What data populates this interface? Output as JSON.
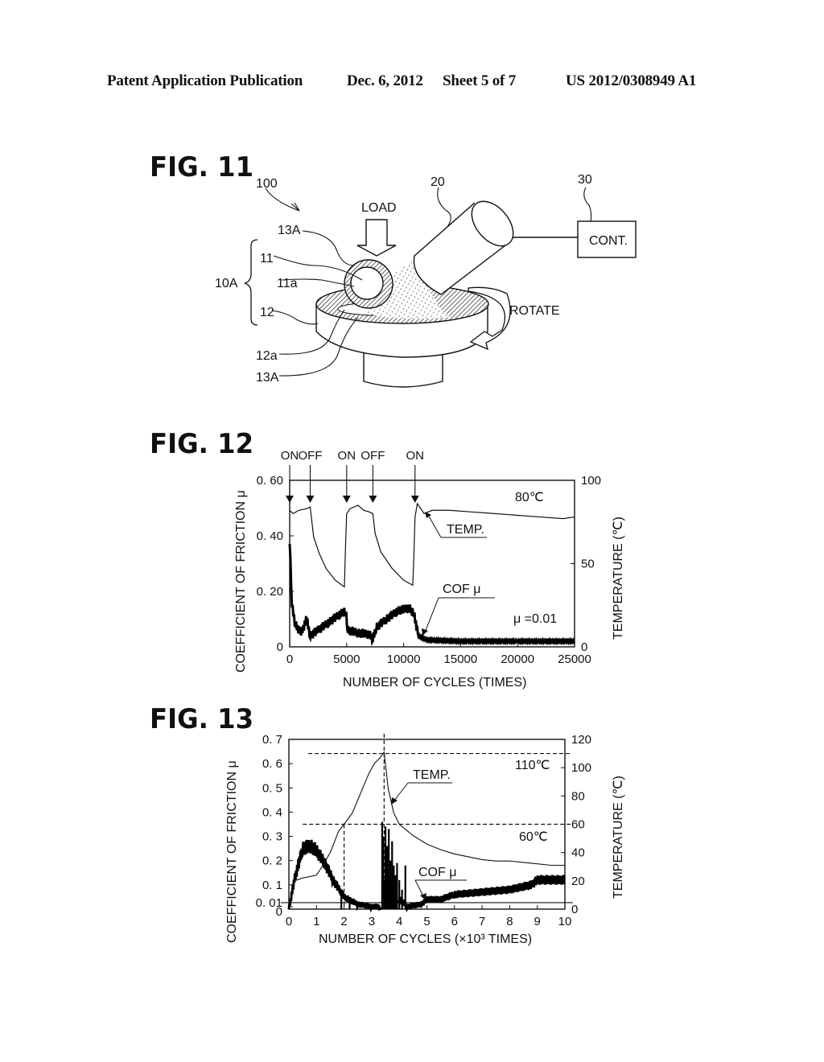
{
  "header": {
    "publication": "Patent Application Publication",
    "date": "Dec. 6, 2012",
    "sheet": "Sheet 5 of 7",
    "number": "US 2012/0308949 A1"
  },
  "fig11": {
    "title": "FIG. 11",
    "labels": {
      "apparatus": "100",
      "load": "LOAD",
      "coating_top": "13A",
      "ball": "11",
      "ball_surface": "11a",
      "assembly": "10A",
      "disk": "12",
      "disk_surface": "12a",
      "coating_bottom": "13A",
      "heater": "20",
      "controller_ref": "30",
      "controller": "CONT.",
      "rotate": "ROTATE"
    }
  },
  "fig12": {
    "title": "FIG. 12",
    "events": [
      "ON",
      "OFF",
      "ON",
      "OFF",
      "ON"
    ],
    "annotations": {
      "temp_label": "TEMP.",
      "cof_label": "COF μ",
      "temp_value": "80℃",
      "mu_value": "μ =0.01"
    }
  },
  "fig13": {
    "title": "FIG. 13",
    "annotations": {
      "temp_label": "TEMP.",
      "cof_label": "COF μ",
      "peak": "110℃",
      "threshold": "60℃"
    }
  },
  "chart_data": [
    {
      "type": "line",
      "title": "FIG. 12",
      "xlabel": "NUMBER OF CYCLES (TIMES)",
      "ylabel": "COEFFICIENT OF FRICTION μ",
      "y2label": "TEMPERATURE (℃)",
      "xlim": [
        0,
        25000
      ],
      "ylim": [
        0,
        0.6
      ],
      "y2lim": [
        0,
        100
      ],
      "xticks": [
        "0",
        "5000",
        "10000",
        "15000",
        "20000",
        "25000"
      ],
      "yticks": [
        "0",
        "0.20",
        "0.40",
        "0.60"
      ],
      "y2ticks": [
        "0",
        "50",
        "100"
      ],
      "event_markers": [
        {
          "label": "ON",
          "x": 0
        },
        {
          "label": "OFF",
          "x": 1800
        },
        {
          "label": "ON",
          "x": 5000
        },
        {
          "label": "OFF",
          "x": 7300
        },
        {
          "label": "ON",
          "x": 11000
        }
      ],
      "series": [
        {
          "name": "TEMP.",
          "axis": "right",
          "x": [
            0,
            300,
            800,
            1500,
            1800,
            2100,
            2600,
            3200,
            4000,
            4800,
            4900,
            5000,
            5300,
            6000,
            6500,
            7000,
            7300,
            7500,
            8000,
            9000,
            10000,
            10800,
            10900,
            11000,
            11200,
            11800,
            12500,
            14000,
            16000,
            18000,
            20000,
            22000,
            24000,
            25000
          ],
          "y": [
            82,
            80,
            82,
            83,
            84,
            66,
            56,
            47,
            40,
            36,
            60,
            80,
            83,
            85,
            82,
            81,
            80,
            68,
            57,
            47,
            40,
            37,
            55,
            78,
            86,
            80,
            82,
            82,
            81,
            80,
            79,
            78,
            77,
            78
          ]
        },
        {
          "name": "COF μ",
          "axis": "left",
          "x": [
            0,
            200,
            500,
            1000,
            1500,
            1800,
            2500,
            3500,
            4500,
            4900,
            5100,
            6000,
            7000,
            7300,
            7600,
            8500,
            9500,
            10500,
            10900,
            11300,
            12000,
            15000,
            20000,
            25000
          ],
          "y": [
            0.38,
            0.15,
            0.08,
            0.05,
            0.1,
            0.04,
            0.06,
            0.09,
            0.12,
            0.13,
            0.06,
            0.05,
            0.045,
            0.03,
            0.07,
            0.1,
            0.13,
            0.14,
            0.12,
            0.04,
            0.025,
            0.02,
            0.02,
            0.02
          ]
        }
      ]
    },
    {
      "type": "line",
      "title": "FIG. 13",
      "xlabel": "NUMBER OF CYCLES (×10³ TIMES)",
      "ylabel": "COEFFICIENT OF FRICTION μ",
      "y2label": "TEMPERATURE (℃)",
      "xlim": [
        0,
        10
      ],
      "ylim": [
        0,
        0.7
      ],
      "y2lim": [
        0,
        120
      ],
      "xticks": [
        "0",
        "1",
        "2",
        "3",
        "4",
        "5",
        "6",
        "7",
        "8",
        "9",
        "10"
      ],
      "yticks": [
        "0",
        "0.01",
        "0.1",
        "0.2",
        "0.3",
        "0.4",
        "0.5",
        "0.6",
        "0.7"
      ],
      "y2ticks": [
        "0",
        "20",
        "40",
        "60",
        "80",
        "100",
        "120"
      ],
      "reference_lines": [
        {
          "axis": "right",
          "y": 110,
          "label": "110℃"
        },
        {
          "axis": "right",
          "y": 60,
          "label": "60℃"
        },
        {
          "axis": "left",
          "y": 0.01
        },
        {
          "axis": "x",
          "x": 2.0
        },
        {
          "axis": "x",
          "x": 3.45
        }
      ],
      "series": [
        {
          "name": "TEMP.",
          "axis": "right",
          "x": [
            0,
            0.2,
            0.5,
            1.0,
            1.2,
            1.5,
            1.8,
            2.0,
            2.3,
            2.6,
            2.9,
            3.1,
            3.3,
            3.45,
            3.6,
            3.8,
            4.0,
            4.5,
            5.0,
            5.5,
            6.0,
            6.5,
            7.0,
            7.5,
            8.0,
            8.5,
            9.0,
            9.5,
            10.0
          ],
          "y": [
            0,
            20,
            22,
            24,
            30,
            40,
            55,
            60,
            68,
            82,
            96,
            103,
            107,
            111,
            85,
            68,
            60,
            52,
            46,
            42,
            39,
            37,
            35,
            34,
            34,
            33,
            32,
            31,
            31
          ]
        },
        {
          "name": "COF μ",
          "axis": "left",
          "x": [
            0,
            0.2,
            0.5,
            0.8,
            1.0,
            1.3,
            1.6,
            2.0,
            2.5,
            3.0,
            3.3,
            3.4,
            3.6,
            3.8,
            4.0,
            4.3,
            4.8,
            5.0,
            5.5,
            6.0,
            7.0,
            8.0,
            8.8,
            9.0,
            10.0
          ],
          "y": [
            0.0,
            0.12,
            0.25,
            0.26,
            0.24,
            0.19,
            0.12,
            0.05,
            0.02,
            0.01,
            0.01,
            0.35,
            0.25,
            0.15,
            0.04,
            0.01,
            0.02,
            0.04,
            0.04,
            0.06,
            0.07,
            0.08,
            0.1,
            0.12,
            0.12
          ]
        }
      ]
    }
  ]
}
